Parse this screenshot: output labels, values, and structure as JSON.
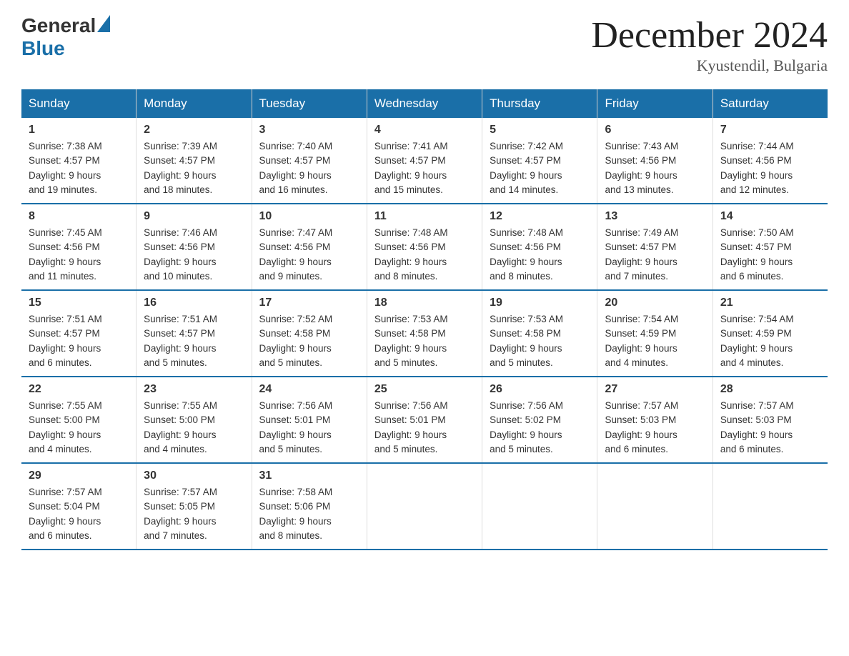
{
  "logo": {
    "general": "General",
    "blue": "Blue"
  },
  "title": "December 2024",
  "subtitle": "Kyustendil, Bulgaria",
  "days_of_week": [
    "Sunday",
    "Monday",
    "Tuesday",
    "Wednesday",
    "Thursday",
    "Friday",
    "Saturday"
  ],
  "weeks": [
    [
      {
        "day": "1",
        "sunrise": "7:38 AM",
        "sunset": "4:57 PM",
        "daylight": "9 hours and 19 minutes."
      },
      {
        "day": "2",
        "sunrise": "7:39 AM",
        "sunset": "4:57 PM",
        "daylight": "9 hours and 18 minutes."
      },
      {
        "day": "3",
        "sunrise": "7:40 AM",
        "sunset": "4:57 PM",
        "daylight": "9 hours and 16 minutes."
      },
      {
        "day": "4",
        "sunrise": "7:41 AM",
        "sunset": "4:57 PM",
        "daylight": "9 hours and 15 minutes."
      },
      {
        "day": "5",
        "sunrise": "7:42 AM",
        "sunset": "4:57 PM",
        "daylight": "9 hours and 14 minutes."
      },
      {
        "day": "6",
        "sunrise": "7:43 AM",
        "sunset": "4:56 PM",
        "daylight": "9 hours and 13 minutes."
      },
      {
        "day": "7",
        "sunrise": "7:44 AM",
        "sunset": "4:56 PM",
        "daylight": "9 hours and 12 minutes."
      }
    ],
    [
      {
        "day": "8",
        "sunrise": "7:45 AM",
        "sunset": "4:56 PM",
        "daylight": "9 hours and 11 minutes."
      },
      {
        "day": "9",
        "sunrise": "7:46 AM",
        "sunset": "4:56 PM",
        "daylight": "9 hours and 10 minutes."
      },
      {
        "day": "10",
        "sunrise": "7:47 AM",
        "sunset": "4:56 PM",
        "daylight": "9 hours and 9 minutes."
      },
      {
        "day": "11",
        "sunrise": "7:48 AM",
        "sunset": "4:56 PM",
        "daylight": "9 hours and 8 minutes."
      },
      {
        "day": "12",
        "sunrise": "7:48 AM",
        "sunset": "4:56 PM",
        "daylight": "9 hours and 8 minutes."
      },
      {
        "day": "13",
        "sunrise": "7:49 AM",
        "sunset": "4:57 PM",
        "daylight": "9 hours and 7 minutes."
      },
      {
        "day": "14",
        "sunrise": "7:50 AM",
        "sunset": "4:57 PM",
        "daylight": "9 hours and 6 minutes."
      }
    ],
    [
      {
        "day": "15",
        "sunrise": "7:51 AM",
        "sunset": "4:57 PM",
        "daylight": "9 hours and 6 minutes."
      },
      {
        "day": "16",
        "sunrise": "7:51 AM",
        "sunset": "4:57 PM",
        "daylight": "9 hours and 5 minutes."
      },
      {
        "day": "17",
        "sunrise": "7:52 AM",
        "sunset": "4:58 PM",
        "daylight": "9 hours and 5 minutes."
      },
      {
        "day": "18",
        "sunrise": "7:53 AM",
        "sunset": "4:58 PM",
        "daylight": "9 hours and 5 minutes."
      },
      {
        "day": "19",
        "sunrise": "7:53 AM",
        "sunset": "4:58 PM",
        "daylight": "9 hours and 5 minutes."
      },
      {
        "day": "20",
        "sunrise": "7:54 AM",
        "sunset": "4:59 PM",
        "daylight": "9 hours and 4 minutes."
      },
      {
        "day": "21",
        "sunrise": "7:54 AM",
        "sunset": "4:59 PM",
        "daylight": "9 hours and 4 minutes."
      }
    ],
    [
      {
        "day": "22",
        "sunrise": "7:55 AM",
        "sunset": "5:00 PM",
        "daylight": "9 hours and 4 minutes."
      },
      {
        "day": "23",
        "sunrise": "7:55 AM",
        "sunset": "5:00 PM",
        "daylight": "9 hours and 4 minutes."
      },
      {
        "day": "24",
        "sunrise": "7:56 AM",
        "sunset": "5:01 PM",
        "daylight": "9 hours and 5 minutes."
      },
      {
        "day": "25",
        "sunrise": "7:56 AM",
        "sunset": "5:01 PM",
        "daylight": "9 hours and 5 minutes."
      },
      {
        "day": "26",
        "sunrise": "7:56 AM",
        "sunset": "5:02 PM",
        "daylight": "9 hours and 5 minutes."
      },
      {
        "day": "27",
        "sunrise": "7:57 AM",
        "sunset": "5:03 PM",
        "daylight": "9 hours and 6 minutes."
      },
      {
        "day": "28",
        "sunrise": "7:57 AM",
        "sunset": "5:03 PM",
        "daylight": "9 hours and 6 minutes."
      }
    ],
    [
      {
        "day": "29",
        "sunrise": "7:57 AM",
        "sunset": "5:04 PM",
        "daylight": "9 hours and 6 minutes."
      },
      {
        "day": "30",
        "sunrise": "7:57 AM",
        "sunset": "5:05 PM",
        "daylight": "9 hours and 7 minutes."
      },
      {
        "day": "31",
        "sunrise": "7:58 AM",
        "sunset": "5:06 PM",
        "daylight": "9 hours and 8 minutes."
      },
      null,
      null,
      null,
      null
    ]
  ],
  "labels": {
    "sunrise": "Sunrise:",
    "sunset": "Sunset:",
    "daylight": "Daylight:"
  }
}
